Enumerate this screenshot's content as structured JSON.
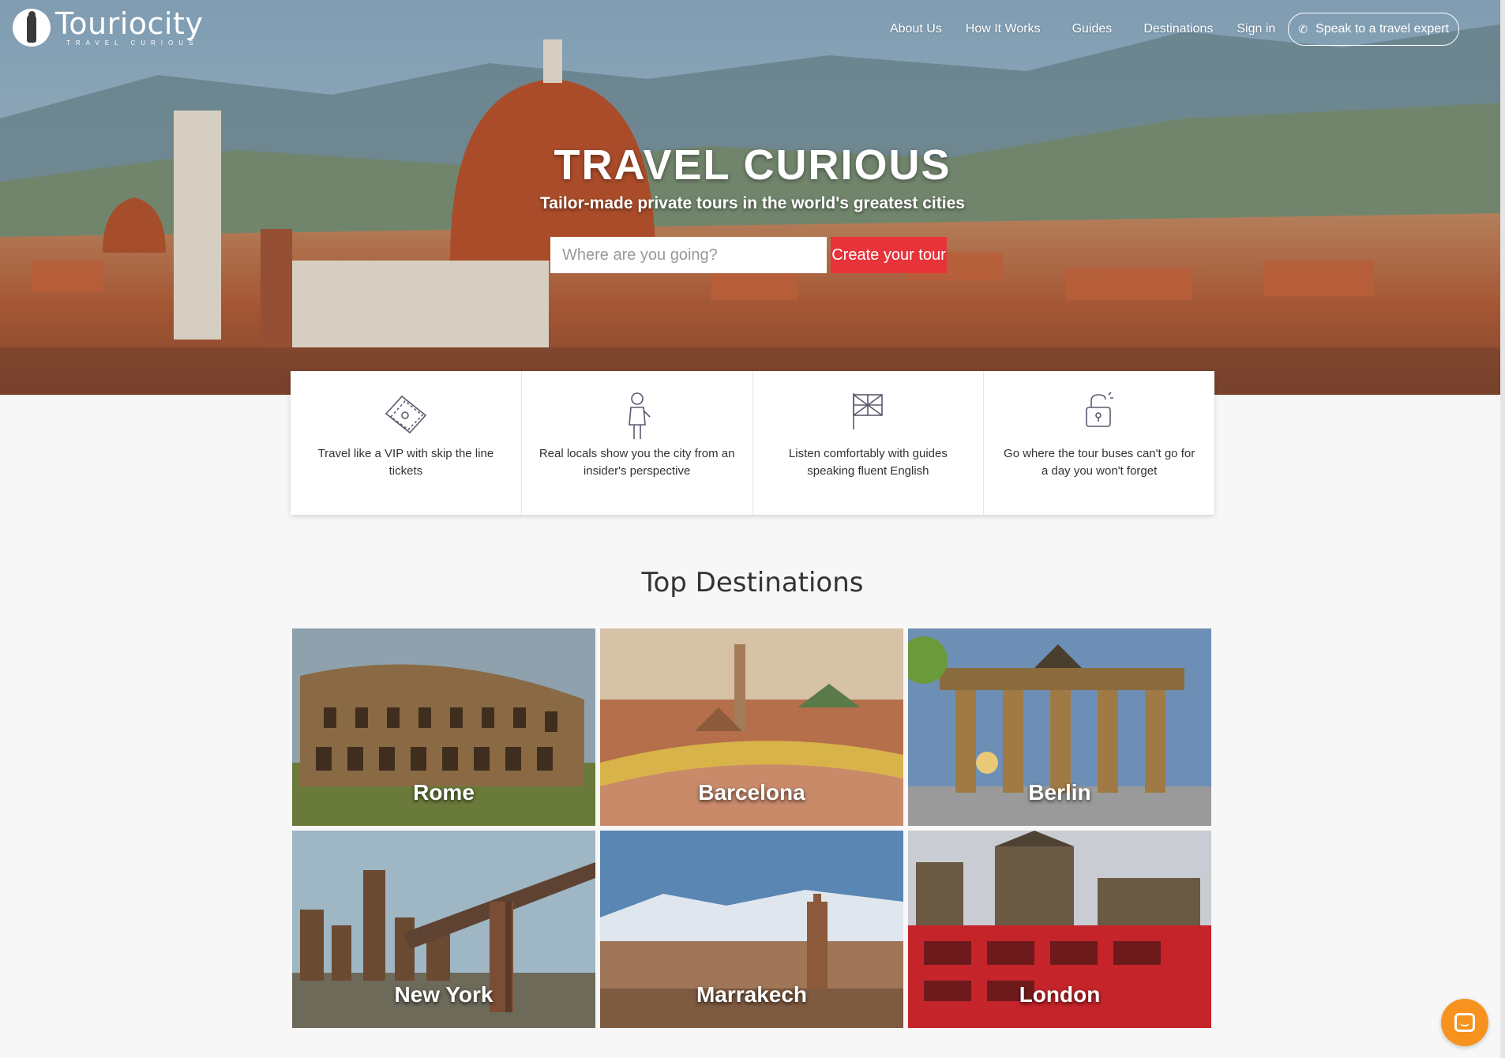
{
  "brand": {
    "name": "Touriocity",
    "tagline": "TRAVEL CURIOUS"
  },
  "nav": {
    "items": [
      "About Us",
      "How It Works",
      "Guides",
      "Destinations",
      "Sign in"
    ],
    "cta": "Speak to a travel expert"
  },
  "hero": {
    "title": "TRAVEL CURIOUS",
    "subtitle": "Tailor-made private tours in the world's greatest cities",
    "search_placeholder": "Where are you going?",
    "search_button": "Create your tour"
  },
  "features": [
    {
      "icon": "ticket-icon",
      "text": "Travel like a VIP with skip the line tickets"
    },
    {
      "icon": "local-guide-icon",
      "text": "Real locals show you the city from an insider's perspective"
    },
    {
      "icon": "uk-flag-icon",
      "text": "Listen comfortably with guides speaking fluent English"
    },
    {
      "icon": "unlock-icon",
      "text": "Go where the tour buses can't go for a day you won't forget"
    }
  ],
  "destinations": {
    "title": "Top Destinations",
    "items": [
      "Rome",
      "Barcelona",
      "Berlin",
      "New York",
      "Marrakech",
      "London"
    ]
  },
  "colors": {
    "accent": "#e8333a",
    "chat": "#f7921e"
  }
}
